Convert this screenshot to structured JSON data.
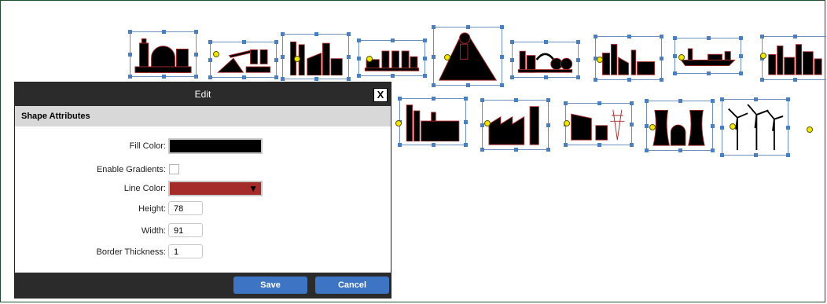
{
  "dialog": {
    "title": "Edit",
    "close_label": "X",
    "section_title": "Shape Attributes",
    "fill_color": {
      "label": "Fill Color:",
      "value": "#000000"
    },
    "enable_gradients": {
      "label": "Enable Gradients:",
      "checked": false
    },
    "line_color": {
      "label": "Line Color:",
      "value": "#a52a2a"
    },
    "height": {
      "label": "Height:",
      "value": "78"
    },
    "width": {
      "label": "Width:",
      "value": "91"
    },
    "border_thickness": {
      "label": "Border Thickness:",
      "value": "1"
    },
    "save_label": "Save",
    "cancel_label": "Cancel"
  },
  "icons": [
    "refinery-icon",
    "mining-conveyor-icon",
    "processing-plant-icon",
    "silo-truck-icon",
    "mine-headframe-icon",
    "pulley-factory-icon",
    "industrial-buildings-icon",
    "cargo-ship-icon",
    "factory-skyline-icon",
    "chemical-plant-icon",
    "sawtooth-factory-icon",
    "hydro-dam-icon",
    "nuclear-plant-icon",
    "wind-turbines-icon"
  ]
}
